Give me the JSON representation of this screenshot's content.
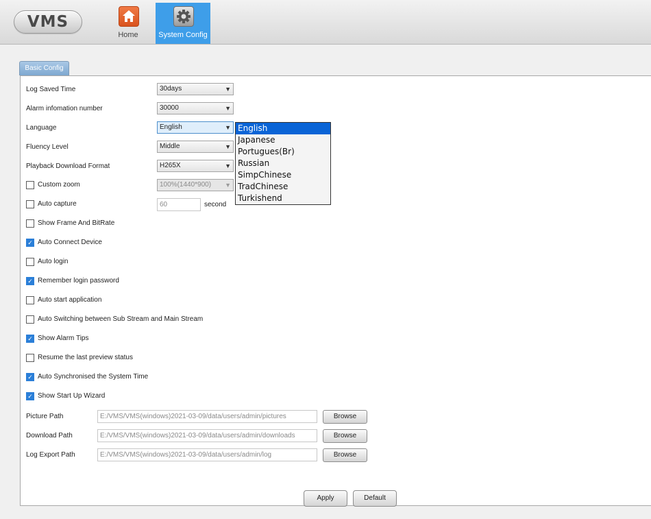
{
  "app": {
    "logo": "VMS"
  },
  "nav": [
    {
      "label": "Home",
      "icon": "home-icon"
    },
    {
      "label": "System Config",
      "icon": "gear-icon",
      "active": true
    }
  ],
  "tab": {
    "label": "Basic Config"
  },
  "settings": {
    "log_saved_time": {
      "label": "Log Saved Time",
      "value": "30days"
    },
    "alarm_info_number": {
      "label": "Alarm infomation number",
      "value": "30000"
    },
    "language": {
      "label": "Language",
      "value": "English"
    },
    "fluency_level": {
      "label": "Fluency Level",
      "value": "Middle"
    },
    "playback_format": {
      "label": "Playback Download Format",
      "value": "H265X"
    },
    "custom_zoom": {
      "label": "Custom zoom",
      "checked": false,
      "value": "100%(1440*900)"
    },
    "auto_capture": {
      "label": "Auto capture",
      "checked": false,
      "value": "60",
      "unit": "second"
    }
  },
  "checkboxes": [
    {
      "label": "Show Frame And BitRate",
      "checked": false
    },
    {
      "label": "Auto Connect Device",
      "checked": true
    },
    {
      "label": "Auto login",
      "checked": false
    },
    {
      "label": "Remember login password",
      "checked": true
    },
    {
      "label": "Auto start application",
      "checked": false
    },
    {
      "label": "Auto Switching between Sub Stream and Main Stream",
      "checked": false
    },
    {
      "label": "Show Alarm Tips",
      "checked": true
    },
    {
      "label": "Resume the last preview status",
      "checked": false
    },
    {
      "label": "Auto Synchronised the System Time",
      "checked": true
    },
    {
      "label": "Show Start Up Wizard",
      "checked": true
    }
  ],
  "paths": [
    {
      "label": "Picture Path",
      "value": "E:/VMS/VMS(windows)2021-03-09/data/users/admin/pictures",
      "button": "Browse"
    },
    {
      "label": "Download Path",
      "value": "E:/VMS/VMS(windows)2021-03-09/data/users/admin/downloads",
      "button": "Browse"
    },
    {
      "label": "Log Export Path",
      "value": "E:/VMS/VMS(windows)2021-03-09/data/users/admin/log",
      "button": "Browse"
    }
  ],
  "language_options": [
    "English",
    "Japanese",
    "Portugues(Br)",
    "Russian",
    "SimpChinese",
    "TradChinese",
    "Turkishend"
  ],
  "selected_language_index": 0,
  "actions": {
    "apply": "Apply",
    "default": "Default"
  },
  "colors": {
    "accent": "#3e9ee9",
    "selection": "#0a64d6",
    "checkbox": "#2b7fd8"
  }
}
